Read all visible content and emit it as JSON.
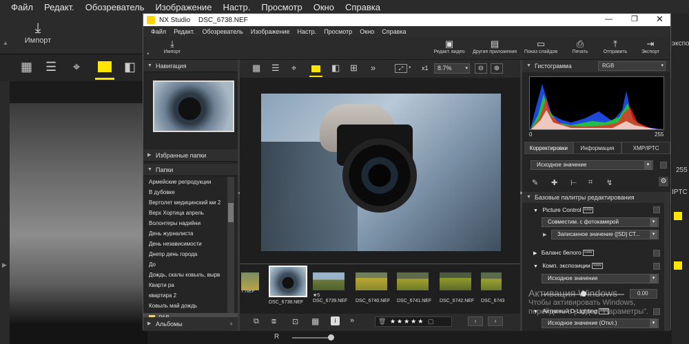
{
  "bg": {
    "menu": [
      "Файл",
      "Редакт.",
      "Обозреватель",
      "Изображение",
      "Настр.",
      "Просмотр",
      "Окно",
      "Справка"
    ],
    "import_label": "Импорт",
    "right_label_1": "экспорт",
    "right_label_2": "255",
    "right_label_3": "IPTC",
    "bottom_r": "R"
  },
  "window": {
    "title": "NX Studio",
    "filename": "DSC_6738.NEF",
    "menu": [
      "Файл",
      "Редакт.",
      "Обозреватель",
      "Изображение",
      "Настр.",
      "Просмотр",
      "Окно",
      "Справка"
    ],
    "toolbar": {
      "import": "Импорт",
      "edit_video": "Редакт. видео",
      "other_apps": "Другие приложения",
      "slideshow": "Показ слайдов",
      "print": "Печать",
      "send": "Отправить",
      "export": "Экспорт"
    },
    "zoom": {
      "mode": "x1",
      "value": "8.7%"
    }
  },
  "left": {
    "navigation": "Навигация",
    "favorites": "Избранные папки",
    "folders": "Папки",
    "folder_items": [
      "Армейские репродукции",
      "В дубовке",
      "Вертолет медицинский ми 2",
      "Верх Хортица апрель",
      "Волонтеры надийни",
      "День журналиста",
      "День независимости",
      "Днепр день города",
      "До",
      "Дождь, скалы ковыль, вырв",
      "Кварти ра",
      "квартира 2",
      "Ковыль май дождь"
    ],
    "selected_folder": "РАВ",
    "albums": "Альбомы"
  },
  "filmstrip": {
    "items": [
      {
        "label": "7.NEF"
      },
      {
        "label": "DSC_6738.NEF"
      },
      {
        "label": "DSC_6739.NEF"
      },
      {
        "label": "DSC_6740.NEF"
      },
      {
        "label": "DSC_6741.NEF"
      },
      {
        "label": "DSC_6742.NEF"
      },
      {
        "label": "DSC_6743"
      }
    ],
    "rating_text": "★5"
  },
  "right": {
    "histogram": "Гистограмма",
    "channel": "RGB",
    "hist_min": "0",
    "hist_max": "255",
    "tabs": [
      "Корректировки",
      "Информация",
      "XMP/IPTC"
    ],
    "preset": "Исходное значение",
    "basic_palettes": "Базовые палитры редактирования",
    "picture_control": "Picture Control",
    "pc_value": "Совместим. с фотокамерой",
    "pc_recorded": "Записанное значение ([SD] СТ...",
    "white_balance": "Баланс белого",
    "exposure_comp": "Комп. экспозиции",
    "exp_value": "Исходное значение",
    "exp_number": "0.00",
    "active_dlighting": "Активный D-Lighting",
    "adl_value": "Исходное значение (Откл.)",
    "raw_tag": "RAW"
  },
  "watermark": {
    "line1": "Активация Windows",
    "line2": "Чтобы активировать Windows, перейдите в раздел \"Параметры\"."
  }
}
